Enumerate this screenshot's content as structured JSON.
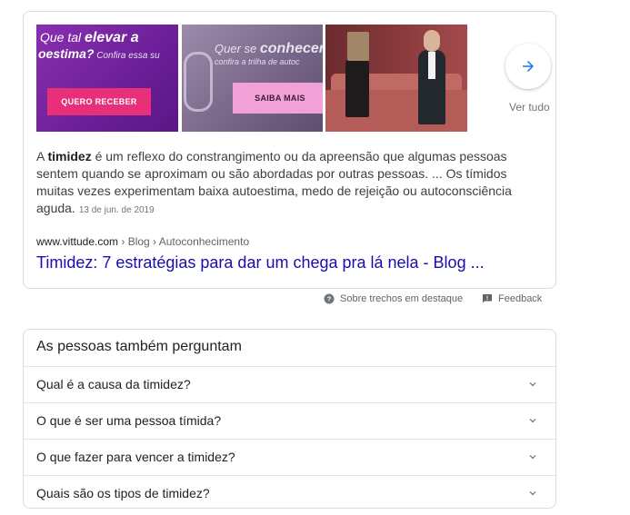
{
  "snippet": {
    "images": [
      {
        "line1": "Que tal ",
        "line1_em": "elevar a",
        "line2": "oestima?",
        "line2_small": " Confira essa su",
        "button": "QUERO RECEBER"
      },
      {
        "line1": "Quer se ",
        "line1_em": "conhecer",
        "line2": "confira a trilha de autoc",
        "button": "SAIBA MAIS"
      },
      {}
    ],
    "see_all_label": "Ver tudo",
    "text_bold": "timidez",
    "text_before": "A ",
    "text_after": " é um reflexo do constrangimento ou da apreensão que algumas pessoas sentem quando se aproximam ou são abordadas por outras pessoas. ... Os tímidos muitas vezes experimentam baixa autoestima, medo de rejeição ou autoconsciência aguda.",
    "date": "13 de jun. de 2019",
    "site": "www.vittude.com",
    "path": " › Blog › Autoconhecimento",
    "link_title": "Timidez: 7 estratégias para dar um chega pra lá nela - Blog ..."
  },
  "footer": {
    "about_label": "Sobre trechos em destaque",
    "feedback_label": "Feedback"
  },
  "paa": {
    "title": "As pessoas também perguntam",
    "questions": [
      "Qual é a causa da timidez?",
      "O que é ser uma pessoa tímida?",
      "O que fazer para vencer a timidez?",
      "Quais são os tipos de timidez?"
    ]
  },
  "colors": {
    "link": "#1a0dab",
    "accent_blue": "#1a73e8",
    "border": "#dadce0"
  }
}
